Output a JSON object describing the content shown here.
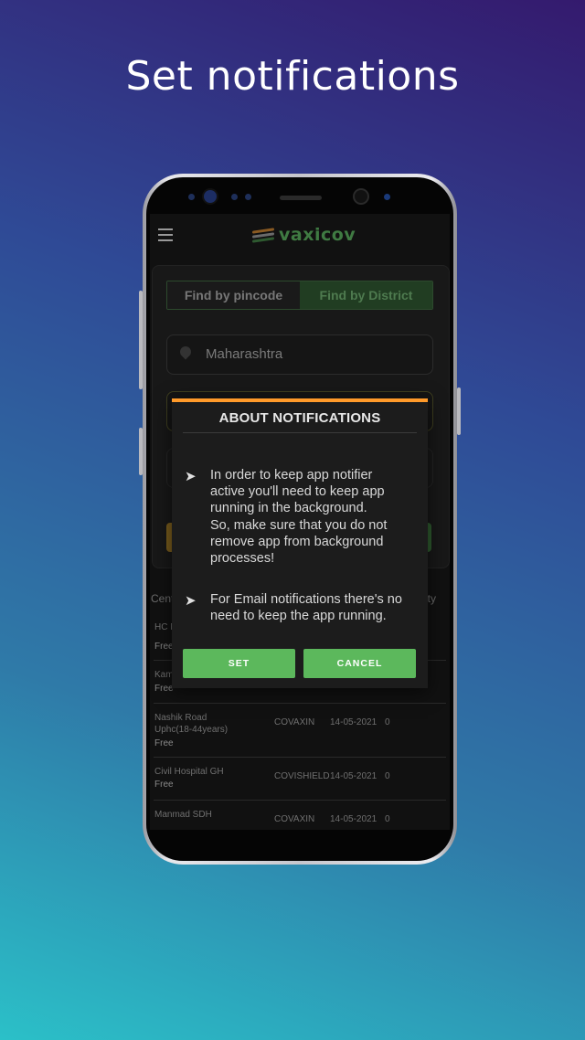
{
  "headline": "Set notifications",
  "app": {
    "brand": "vaxicov",
    "tabs": [
      {
        "label": "Find by pincode",
        "active": false
      },
      {
        "label": "Find by District",
        "active": true
      }
    ],
    "state_field_value": "Maharashtra",
    "table": {
      "header_left": "Cent",
      "header_right": "ity",
      "rows": [
        {
          "name": "HC N",
          "fee": "Free",
          "vaccine": "",
          "date": "",
          "capacity": ""
        },
        {
          "name": "Kam",
          "fee": "Free",
          "vaccine": "",
          "date": "",
          "capacity": ""
        },
        {
          "name": "Nashik Road\nUphc(18-44years)",
          "fee": "Free",
          "vaccine": "COVAXIN",
          "date": "14-05-2021",
          "capacity": "0"
        },
        {
          "name": "Civil Hospital GH",
          "fee": "Free",
          "vaccine": "COVISHIELD",
          "date": "14-05-2021",
          "capacity": "0"
        },
        {
          "name": "Manmad SDH",
          "fee": "",
          "vaccine": "COVAXIN",
          "date": "14-05-2021",
          "capacity": "0"
        }
      ]
    }
  },
  "dialog": {
    "title": "ABOUT NOTIFICATIONS",
    "bullet_glyph": "➤",
    "point1": "In order to keep app notifier\nactive you'll need to keep app\nrunning in the background.\nSo, make sure that you do not\nremove app from background\nprocesses!",
    "point2": "For Email notifications there's no\nneed to keep the app running.",
    "set_label": "SET",
    "cancel_label": "CANCEL"
  },
  "colors": {
    "accent_orange": "#ff9a2a",
    "button_green": "#5cb85c",
    "brand_green": "#3f7a42"
  }
}
